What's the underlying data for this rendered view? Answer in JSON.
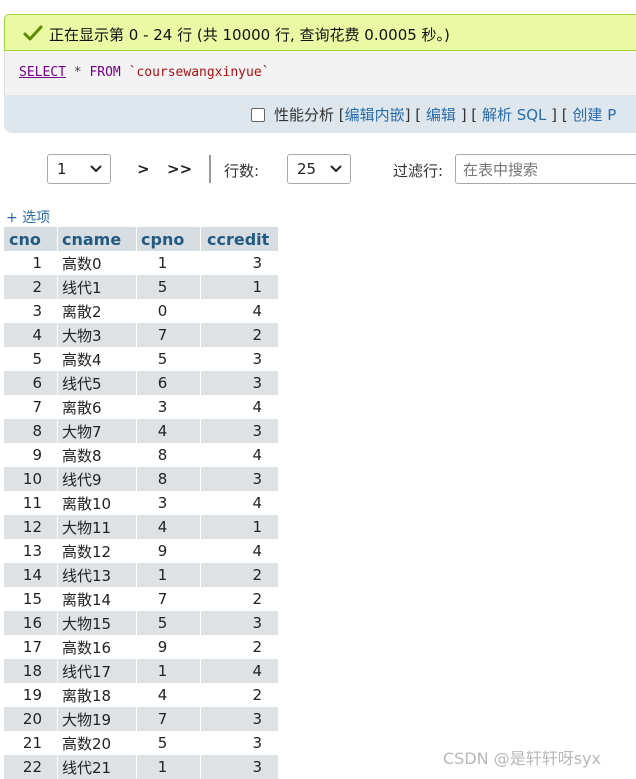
{
  "success": {
    "message": "正在显示第 0 - 24 行 (共 10000 行, 查询花费 0.0005 秒。)",
    "icon": "check-icon",
    "color": "#5a8a00"
  },
  "sql": {
    "select_kw": "SELECT",
    "star": " * ",
    "from_kw": "FROM",
    "table_ident": " `coursewangxinyue`"
  },
  "tools": {
    "profiling_label": "性能分析",
    "links": [
      {
        "label": "编辑内嵌"
      },
      {
        "label": "编辑"
      },
      {
        "label": "解析 SQL"
      },
      {
        "label": "创建 P"
      }
    ]
  },
  "navigation": {
    "page_value": "1",
    "next_label": ">",
    "last_label": ">>",
    "rows_label": "行数:",
    "rows_value": "25",
    "filter_label": "过滤行:",
    "filter_placeholder": "在表中搜索"
  },
  "options_label": "+ 选项",
  "table": {
    "columns": [
      "cno",
      "cname",
      "cpno",
      "ccredit"
    ],
    "rows": [
      [
        "1",
        "高数0",
        "1",
        "3"
      ],
      [
        "2",
        "线代1",
        "5",
        "1"
      ],
      [
        "3",
        "离散2",
        "0",
        "4"
      ],
      [
        "4",
        "大物3",
        "7",
        "2"
      ],
      [
        "5",
        "高数4",
        "5",
        "3"
      ],
      [
        "6",
        "线代5",
        "6",
        "3"
      ],
      [
        "7",
        "离散6",
        "3",
        "4"
      ],
      [
        "8",
        "大物7",
        "4",
        "3"
      ],
      [
        "9",
        "高数8",
        "8",
        "4"
      ],
      [
        "10",
        "线代9",
        "8",
        "3"
      ],
      [
        "11",
        "离散10",
        "3",
        "4"
      ],
      [
        "12",
        "大物11",
        "4",
        "1"
      ],
      [
        "13",
        "高数12",
        "9",
        "4"
      ],
      [
        "14",
        "线代13",
        "1",
        "2"
      ],
      [
        "15",
        "离散14",
        "7",
        "2"
      ],
      [
        "16",
        "大物15",
        "5",
        "3"
      ],
      [
        "17",
        "高数16",
        "9",
        "2"
      ],
      [
        "18",
        "线代17",
        "1",
        "4"
      ],
      [
        "19",
        "离散18",
        "4",
        "2"
      ],
      [
        "20",
        "大物19",
        "7",
        "3"
      ],
      [
        "21",
        "高数20",
        "5",
        "3"
      ],
      [
        "22",
        "线代21",
        "1",
        "3"
      ]
    ]
  },
  "watermark": "CSDN @是轩轩呀syx"
}
